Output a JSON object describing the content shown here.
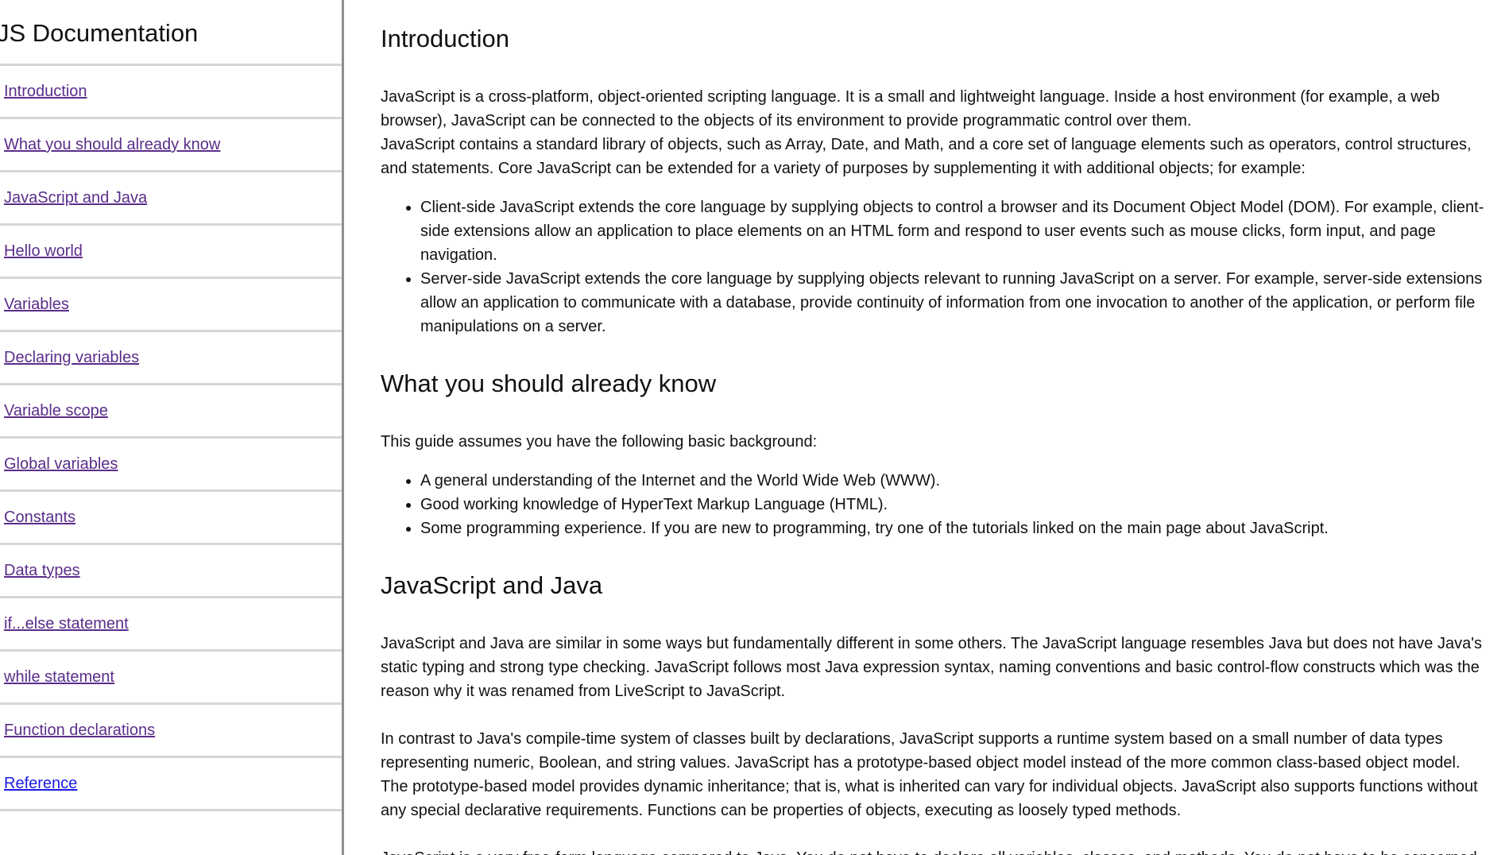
{
  "sidebar": {
    "title": "JS Documentation",
    "items": [
      {
        "label": "Introduction"
      },
      {
        "label": "What you should already know"
      },
      {
        "label": "JavaScript and Java"
      },
      {
        "label": "Hello world"
      },
      {
        "label": "Variables"
      },
      {
        "label": "Declaring variables"
      },
      {
        "label": "Variable scope"
      },
      {
        "label": "Global variables"
      },
      {
        "label": "Constants"
      },
      {
        "label": "Data types"
      },
      {
        "label": "if...else statement"
      },
      {
        "label": "while statement"
      },
      {
        "label": "Function declarations"
      },
      {
        "label": "Reference"
      }
    ]
  },
  "main": {
    "introduction": {
      "heading": "Introduction",
      "paragraph1_line1": "JavaScript is a cross-platform, object-oriented scripting language. It is a small and lightweight language. Inside a host environment (for example, a web browser), JavaScript can be connected to the objects of its environment to provide programmatic control over them.",
      "paragraph1_line2": "JavaScript contains a standard library of objects, such as Array, Date, and Math, and a core set of language elements such as operators, control structures, and statements. Core JavaScript can be extended for a variety of purposes by supplementing it with additional objects; for example:",
      "bullets": [
        "Client-side JavaScript extends the core language by supplying objects to control a browser and its Document Object Model (DOM). For example, client-side extensions allow an application to place elements on an HTML form and respond to user events such as mouse clicks, form input, and page navigation.",
        "Server-side JavaScript extends the core language by supplying objects relevant to running JavaScript on a server. For example, server-side extensions allow an application to communicate with a database, provide continuity of information from one invocation to another of the application, or perform file manipulations on a server."
      ]
    },
    "what_you_should_know": {
      "heading": "What you should already know",
      "paragraph": "This guide assumes you have the following basic background:",
      "bullets": [
        "A general understanding of the Internet and the World Wide Web (WWW).",
        "Good working knowledge of HyperText Markup Language (HTML).",
        "Some programming experience. If you are new to programming, try one of the tutorials linked on the main page about JavaScript."
      ]
    },
    "javascript_and_java": {
      "heading": "JavaScript and Java",
      "paragraph1": "JavaScript and Java are similar in some ways but fundamentally different in some others. The JavaScript language resembles Java but does not have Java's static typing and strong type checking. JavaScript follows most Java expression syntax, naming conventions and basic control-flow constructs which was the reason why it was renamed from LiveScript to JavaScript.",
      "paragraph2": "In contrast to Java's compile-time system of classes built by declarations, JavaScript supports a runtime system based on a small number of data types representing numeric, Boolean, and string values. JavaScript has a prototype-based object model instead of the more common class-based object model. The prototype-based model provides dynamic inheritance; that is, what is inherited can vary for individual objects. JavaScript also supports functions without any special declarative requirements. Functions can be properties of objects, executing as loosely typed methods.",
      "paragraph3": "JavaScript is a very free-form language compared to Java. You do not have to declare all variables, classes, and methods. You do not have to be concerned"
    }
  },
  "colors": {
    "visited_link": "#5b2d8a",
    "unvisited_link": "#1a1ae6",
    "sidebar_border": "#8f8f8f",
    "item_divider": "#d6d6d6"
  }
}
